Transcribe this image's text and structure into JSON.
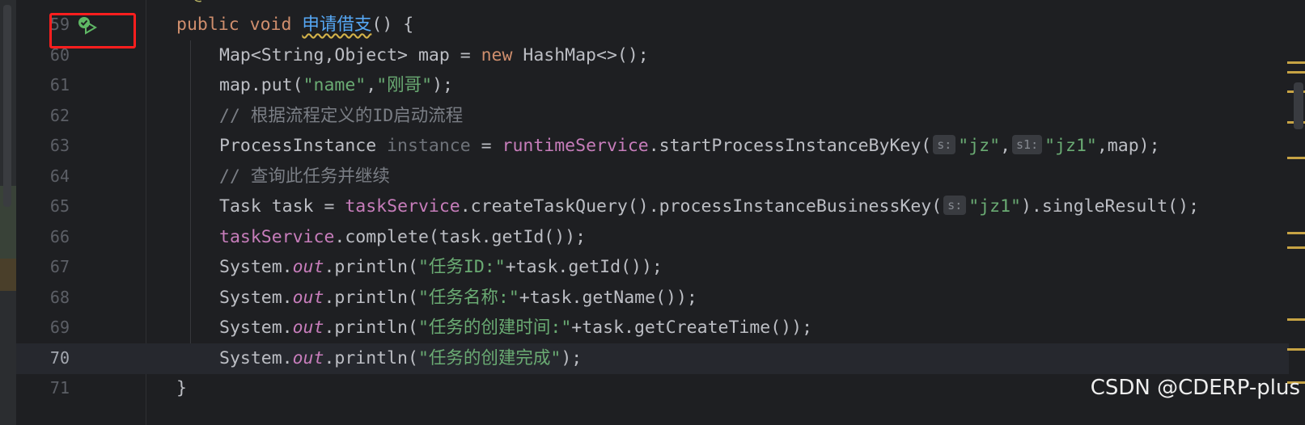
{
  "gutter": {
    "line_numbers": [
      "59",
      "60",
      "61",
      "62",
      "63",
      "64",
      "65",
      "66",
      "67",
      "68",
      "69",
      "70",
      "71"
    ]
  },
  "code": {
    "top_partial": "@Test",
    "l59": {
      "kw_public": "public",
      "kw_void": "void",
      "method_name": "申请借支",
      "rest": "() {"
    },
    "l60": {
      "a": "Map<String,Object> map = ",
      "kw_new": "new",
      "b": " HashMap<>();"
    },
    "l61": {
      "a": "map.put(",
      "s1": "\"name\"",
      "comma": ",",
      "s2": "\"刚哥\"",
      "b": ");"
    },
    "l62": {
      "comment": "// 根据流程定义的ID启动流程"
    },
    "l63": {
      "a": "ProcessInstance ",
      "var": "instance",
      "b": " = ",
      "field": "runtimeService",
      "c": ".startProcessInstanceByKey(",
      "hint1": "s:",
      "s1": "\"jz\"",
      "comma": ",",
      "hint2": "s1:",
      "s2": "\"jz1\"",
      "d": ",map);"
    },
    "l64": {
      "comment": "// 查询此任务并继续"
    },
    "l65": {
      "a": "Task task = ",
      "field": "taskService",
      "b": ".createTaskQuery().processInstanceBusinessKey(",
      "hint": "s:",
      "s": "\"jz1\"",
      "c": ").singleResult();"
    },
    "l66": {
      "field": "taskService",
      "a": ".complete(task.getId());"
    },
    "l67": {
      "a": "System.",
      "out": "out",
      "b": ".println(",
      "s": "\"任务ID:\"",
      "c": "+task.getId());"
    },
    "l68": {
      "a": "System.",
      "out": "out",
      "b": ".println(",
      "s": "\"任务名称:\"",
      "c": "+task.getName());"
    },
    "l69": {
      "a": "System.",
      "out": "out",
      "b": ".println(",
      "s": "\"任务的创建时间:\"",
      "c": "+task.getCreateTime());"
    },
    "l70": {
      "a": "System.",
      "out": "out",
      "b": ".println(",
      "s": "\"任务的创建完成\"",
      "c": ");"
    },
    "l71": {
      "a": "}"
    }
  },
  "current_line": "70",
  "watermark": "CSDN @CDERP-plus",
  "icons": {
    "run_gutter": "run-test-icon",
    "passed": "test-passed-check-icon"
  },
  "colors": {
    "background": "#1e1f22",
    "keyword": "#cf8e6d",
    "string": "#6aab73",
    "comment": "#7a7e85",
    "field": "#c77dbb",
    "method_decl": "#56a8f5",
    "highlight_box": "#ff1e1e"
  }
}
